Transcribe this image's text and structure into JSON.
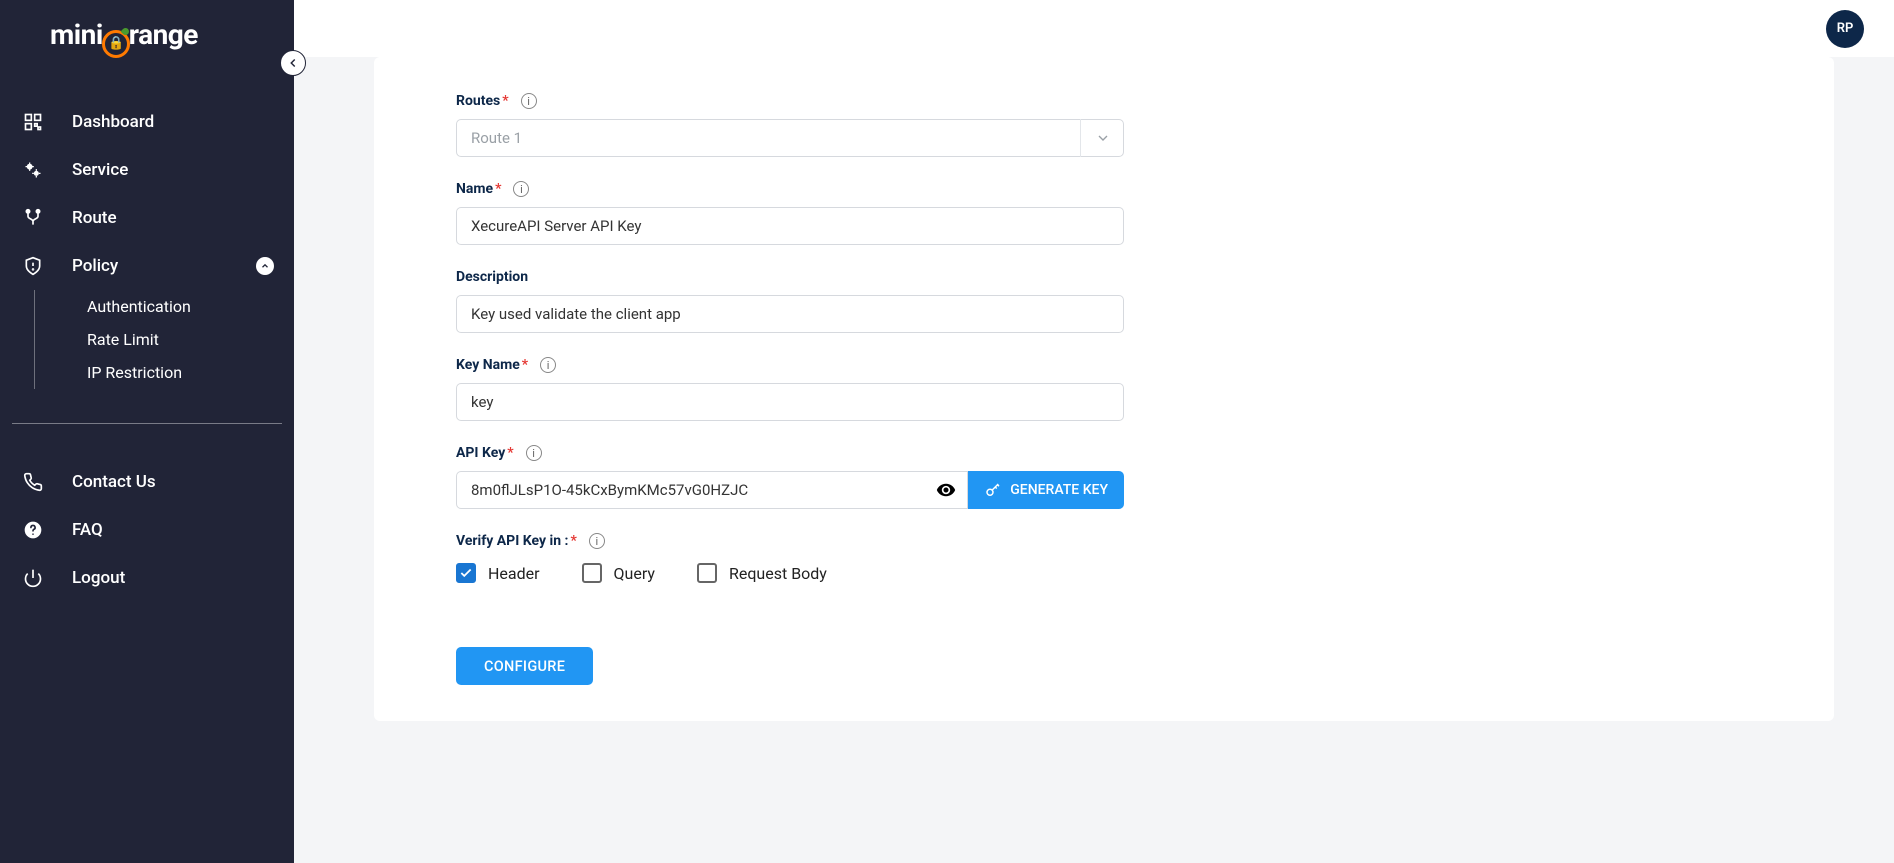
{
  "brand": {
    "prefix": "mini",
    "suffix": "range"
  },
  "user": {
    "initials": "RP"
  },
  "sidebar": {
    "main": [
      {
        "key": "dashboard",
        "label": "Dashboard"
      },
      {
        "key": "service",
        "label": "Service"
      },
      {
        "key": "route",
        "label": "Route"
      },
      {
        "key": "policy",
        "label": "Policy"
      }
    ],
    "policy_sub": [
      {
        "key": "authentication",
        "label": "Authentication"
      },
      {
        "key": "rate-limit",
        "label": "Rate Limit"
      },
      {
        "key": "ip-restriction",
        "label": "IP Restriction"
      }
    ],
    "bottom": [
      {
        "key": "contact-us",
        "label": "Contact Us"
      },
      {
        "key": "faq",
        "label": "FAQ"
      },
      {
        "key": "logout",
        "label": "Logout"
      }
    ]
  },
  "form": {
    "routes": {
      "label": "Routes",
      "value": "Route 1"
    },
    "name": {
      "label": "Name",
      "value": "XecureAPI Server API Key"
    },
    "description": {
      "label": "Description",
      "value": "Key used validate the client app"
    },
    "key_name": {
      "label": "Key Name",
      "value": "key"
    },
    "api_key": {
      "label": "API Key",
      "value": "8m0flJLsP1O-45kCxBymKMc57vG0HZJC",
      "generate_label": "GENERATE KEY"
    },
    "verify": {
      "label": "Verify API Key in :",
      "options": [
        {
          "key": "header",
          "label": "Header",
          "checked": true
        },
        {
          "key": "query",
          "label": "Query",
          "checked": false
        },
        {
          "key": "body",
          "label": "Request Body",
          "checked": false
        }
      ]
    },
    "submit_label": "CONFIGURE"
  }
}
